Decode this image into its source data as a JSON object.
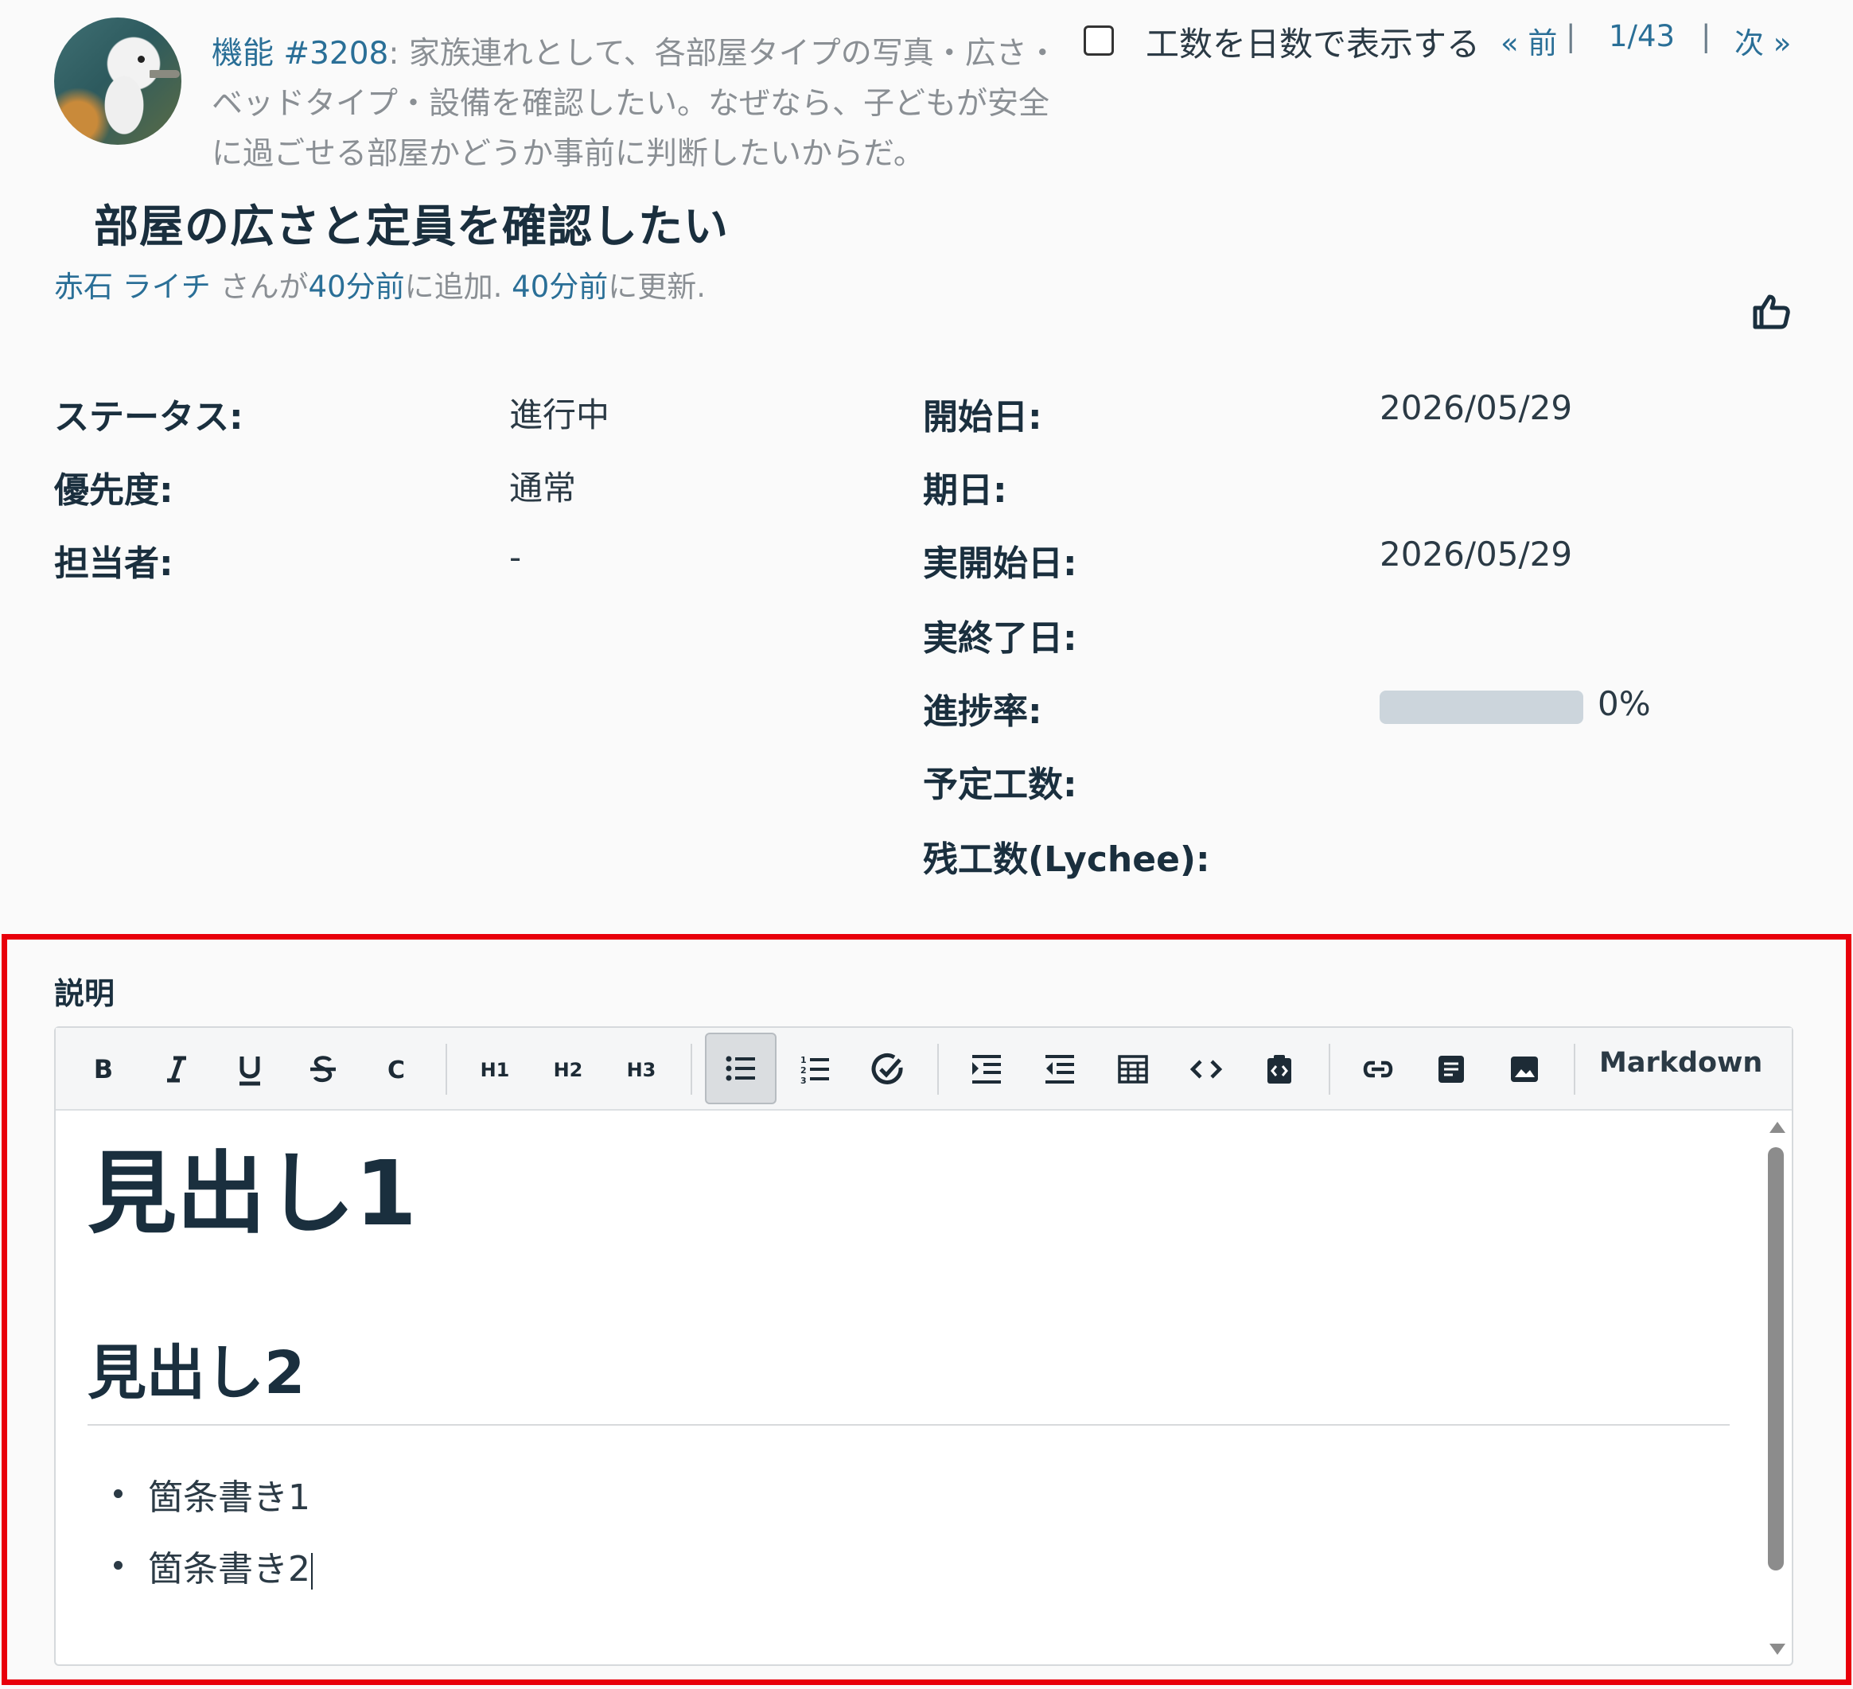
{
  "header": {
    "parent_link": "機能 #3208",
    "parent_subject": ": 家族連れとして、各部屋タイプの写真・広さ・ベッドタイプ・設備を確認したい。なぜなら、子どもが安全に過ごせる部屋かどうか事前に判断したいからだ。",
    "show_days_label": "工数を日数で表示する",
    "pager": {
      "prev": "« 前",
      "current": "1/43",
      "next": "次 »"
    },
    "title": "部屋の広さと定員を確認したい",
    "author_name": "赤石 ライチ",
    "author_added": " さんが",
    "added_ago": "40分前",
    "added_suffix": "に追加. ",
    "updated_ago": "40分前",
    "updated_suffix": "に更新."
  },
  "attributes": {
    "status": {
      "label": "ステータス:",
      "value": "進行中"
    },
    "priority": {
      "label": "優先度:",
      "value": "通常"
    },
    "assignee": {
      "label": "担当者:",
      "value": "-"
    },
    "start_date": {
      "label": "開始日:",
      "value": "2026/05/29"
    },
    "due_date": {
      "label": "期日:",
      "value": ""
    },
    "actual_start": {
      "label": "実開始日:",
      "value": "2026/05/29"
    },
    "actual_end": {
      "label": "実終了日:",
      "value": ""
    },
    "done_ratio": {
      "label": "進捗率:",
      "value": "0%",
      "fraction": 0
    },
    "estimated": {
      "label": "予定工数:",
      "value": ""
    },
    "remaining": {
      "label": "残工数(Lychee):",
      "value": ""
    }
  },
  "description": {
    "label": "説明",
    "toolbar": {
      "buttons": [
        "bold",
        "italic",
        "underline",
        "strikethrough",
        "code",
        "heading-1",
        "heading-2",
        "heading-3",
        "bullet-list",
        "numbered-list",
        "task-list",
        "indent",
        "outdent",
        "table",
        "code-block",
        "paste",
        "link",
        "page",
        "image"
      ],
      "h1": "H1",
      "h2": "H2",
      "h3": "H3",
      "c": "C",
      "markdown": "Markdown"
    },
    "content": {
      "h1": "見出し1",
      "h2": "見出し2",
      "list": [
        "箇条書き1",
        "箇条書き2"
      ]
    }
  },
  "colors": {
    "link": "#2a6f97",
    "highlight_border": "#e8000b",
    "progress_bg": "#ccd5dc"
  }
}
